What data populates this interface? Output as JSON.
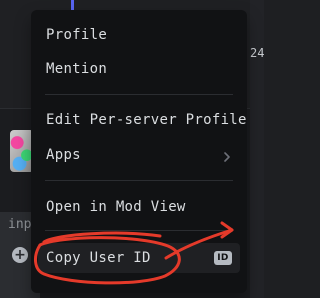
{
  "background": {
    "input_text": "inp",
    "right_label": "24"
  },
  "menu": {
    "items": [
      {
        "label": "Profile"
      },
      {
        "label": "Mention"
      },
      {
        "label": "Edit Per-server Profile"
      },
      {
        "label": "Apps"
      },
      {
        "label": "Open in Mod View"
      },
      {
        "label": "Copy User ID",
        "badge": "ID"
      }
    ]
  },
  "colors": {
    "menu_bg": "#111214",
    "text": "#dbdee1",
    "annotation": "#e53a2a",
    "accent": "#5865f2"
  },
  "icons": {
    "apps_chevron": "chevron-right-icon",
    "copy_id_badge": "id-badge-icon",
    "add": "plus-circle-icon"
  }
}
